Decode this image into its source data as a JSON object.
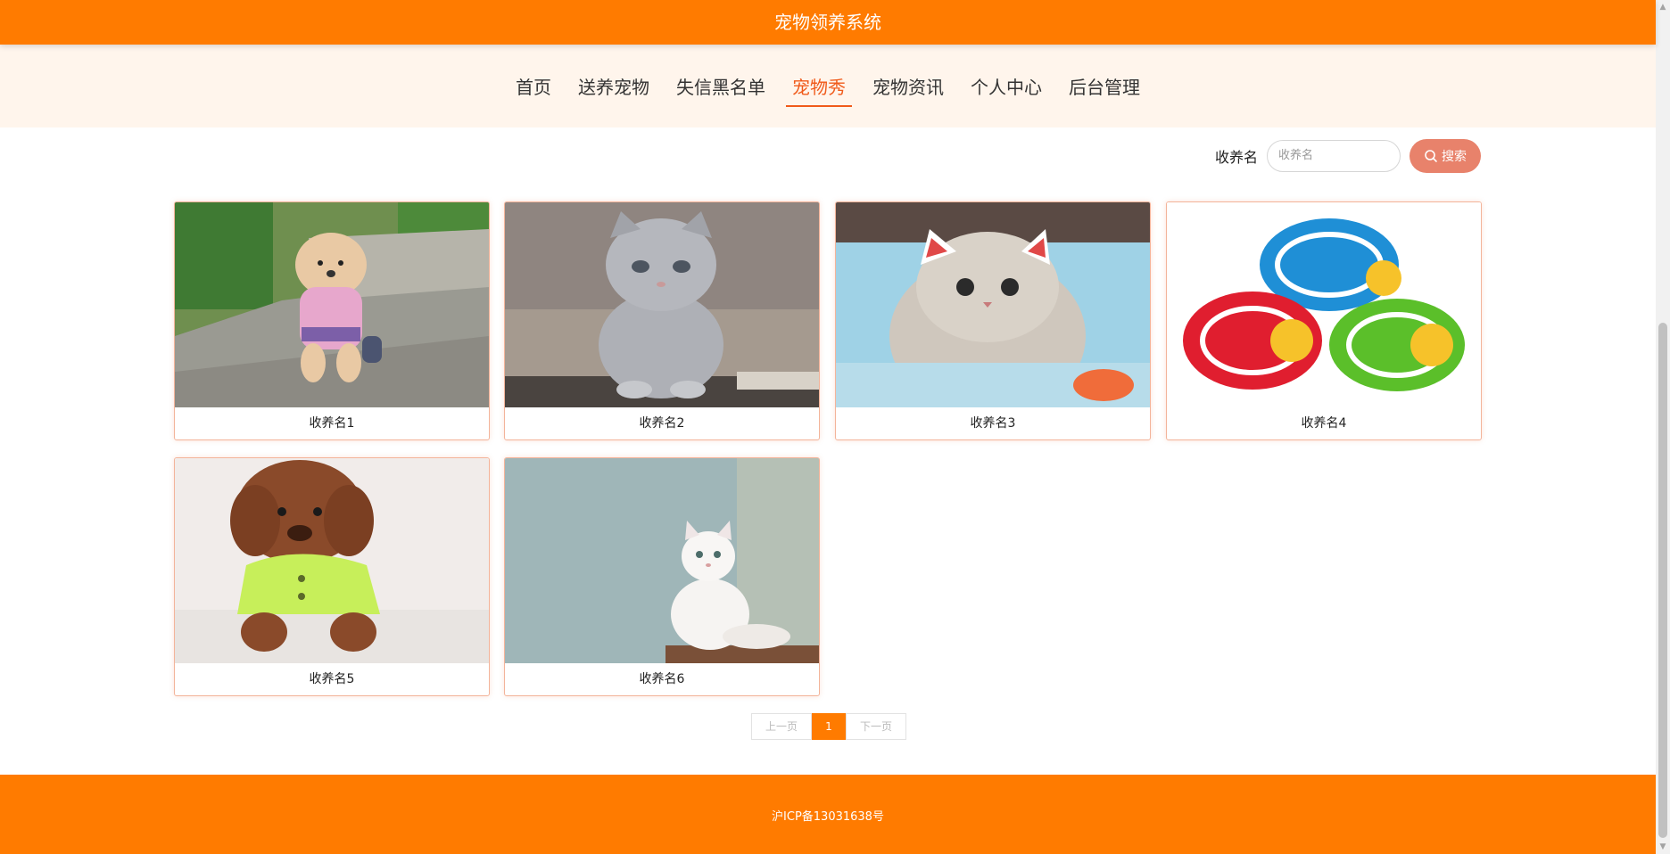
{
  "header": {
    "title": "宠物领养系统"
  },
  "nav": {
    "items": [
      {
        "label": "首页"
      },
      {
        "label": "送养宠物"
      },
      {
        "label": "失信黑名单"
      },
      {
        "label": "宠物秀",
        "active": true
      },
      {
        "label": "宠物资讯"
      },
      {
        "label": "个人中心"
      },
      {
        "label": "后台管理"
      }
    ]
  },
  "search": {
    "label": "收养名",
    "placeholder": "收养名",
    "button_label": "搜索",
    "button_icon": "search-icon"
  },
  "cards": [
    {
      "name": "收养名1",
      "image": "poodle-dog-photo"
    },
    {
      "name": "收养名2",
      "image": "grey-kitten-photo"
    },
    {
      "name": "收养名3",
      "image": "lucky-cat-photo"
    },
    {
      "name": "收养名4",
      "image": "pet-toy-balls-photo"
    },
    {
      "name": "收养名5",
      "image": "brown-poodle-photo"
    },
    {
      "name": "收养名6",
      "image": "white-cat-photo"
    }
  ],
  "pagination": {
    "prev": "上一页",
    "current": "1",
    "next": "下一页"
  },
  "footer": {
    "icp": "沪ICP备13031638号"
  },
  "colors": {
    "primary": "#ff7b00",
    "active_nav": "#f05a1a",
    "search_button": "#e8826b",
    "nav_bg": "#fff5ec"
  }
}
